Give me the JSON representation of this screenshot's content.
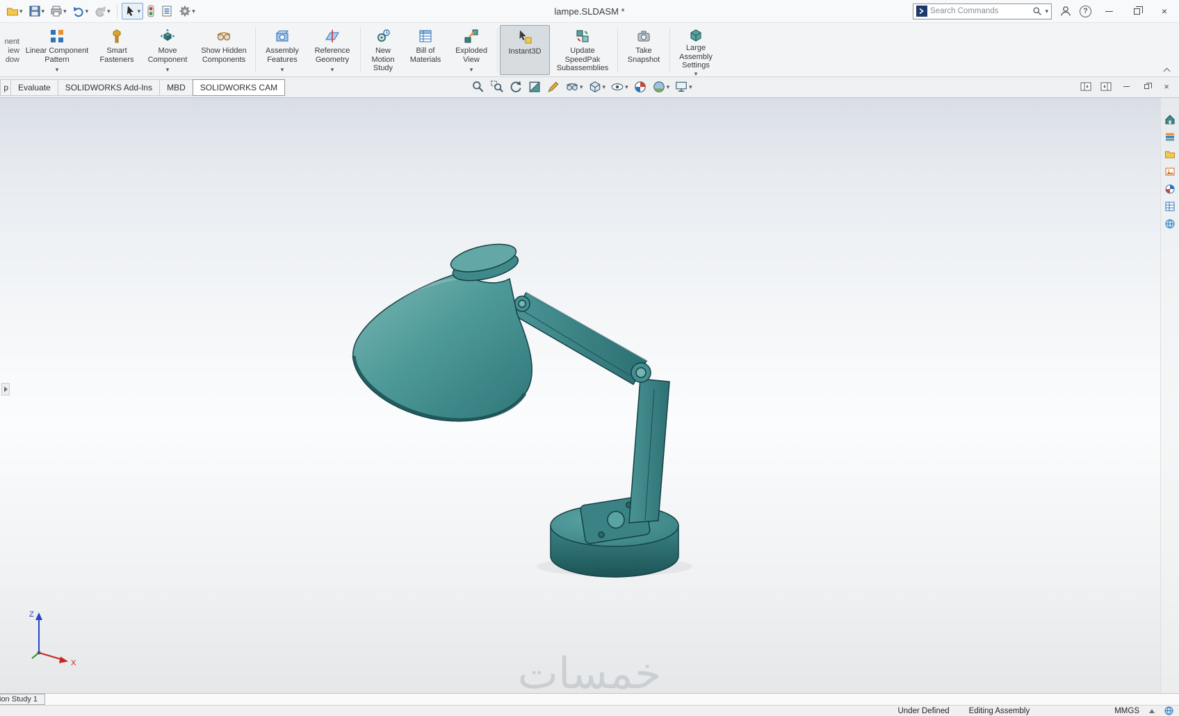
{
  "titlebar": {
    "title": "lampe.SLDASM *",
    "search_placeholder": "Search Commands"
  },
  "icons": {
    "help_glyph": "?",
    "close_glyph": "×"
  },
  "ribbon": {
    "clipped_fragments": [
      "nent",
      "iew",
      "dow"
    ],
    "items": [
      {
        "label": "Linear Component Pattern",
        "dropdown": true
      },
      {
        "label": "Smart Fasteners",
        "dropdown": false
      },
      {
        "label": "Move Component",
        "dropdown": true
      },
      {
        "label": "Show Hidden Components",
        "dropdown": false
      },
      {
        "label": "Assembly Features",
        "dropdown": true
      },
      {
        "label": "Reference Geometry",
        "dropdown": true
      },
      {
        "label": "New Motion Study",
        "dropdown": false
      },
      {
        "label": "Bill of Materials",
        "dropdown": false
      },
      {
        "label": "Exploded View",
        "dropdown": true
      },
      {
        "label": "Instant3D",
        "dropdown": false,
        "active": true
      },
      {
        "label": "Update SpeedPak Subassemblies",
        "dropdown": false
      },
      {
        "label": "Take Snapshot",
        "dropdown": false
      },
      {
        "label": "Large Assembly Settings",
        "dropdown": true
      }
    ]
  },
  "tabs": {
    "clipped_fragment": "p",
    "items": [
      "Evaluate",
      "SOLIDWORKS Add-Ins",
      "MBD",
      "SOLIDWORKS CAM"
    ],
    "active": "SOLIDWORKS CAM"
  },
  "viewport": {
    "watermark": "خمسات",
    "triad": {
      "x_label": "X",
      "z_label": "Z"
    },
    "model_color": "#3f8b8d",
    "model_edge_color": "#143f43"
  },
  "motion_bar": {
    "tab_label": "ion Study 1"
  },
  "statusbar": {
    "constraint_status": "Under Defined",
    "edit_mode": "Editing Assembly",
    "units": "MMGS"
  }
}
